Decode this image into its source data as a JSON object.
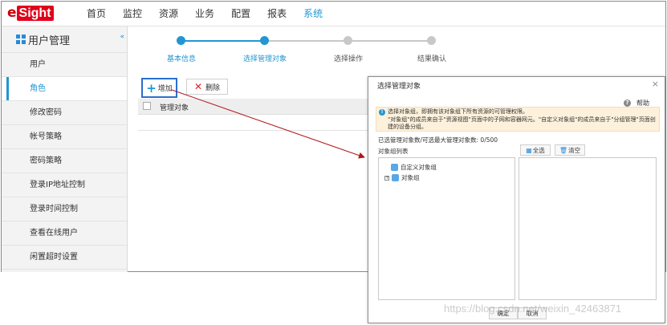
{
  "logo": {
    "e": "e",
    "box": "Sight"
  },
  "nav": [
    "首页",
    "监控",
    "资源",
    "业务",
    "配置",
    "报表",
    "系统"
  ],
  "sidebar": {
    "title": "用户管理",
    "items": [
      "用户",
      "角色",
      "修改密码",
      "帐号策略",
      "密码策略",
      "登录IP地址控制",
      "登录时间控制",
      "查看在线用户",
      "闲置超时设置"
    ]
  },
  "steps": [
    "基本信息",
    "选择管理对象",
    "选择操作",
    "结果确认"
  ],
  "toolbar": {
    "add": "增加",
    "delete": "删除"
  },
  "table": {
    "column": "管理对象"
  },
  "dialog": {
    "title": "选择管理对象",
    "close": "×",
    "help": "帮助",
    "info_line1": "选择对象组，即拥有该对象组下所有资源的可管理权限。",
    "info_line2": "\"对象组\"的成员来自于\"资源视图\"页面中的子网和容器网元。\"自定义对象组\"的成员来自于\"分组管理\"页面创",
    "info_line3": "建的设备分组。",
    "count": "已选管理对象数/可选最大管理对象数: 0/500",
    "list_label": "对象组列表",
    "select_all": "全选",
    "clear": "清空",
    "tree": [
      "自定义对象组",
      "对象组"
    ],
    "ok": "确定",
    "cancel": "取消"
  },
  "watermark": "https://blog.csdn.net/weixin_42463871",
  "colors": {
    "accent": "#2196d3",
    "brand": "#e2001a",
    "arrow": "#b0151c"
  }
}
